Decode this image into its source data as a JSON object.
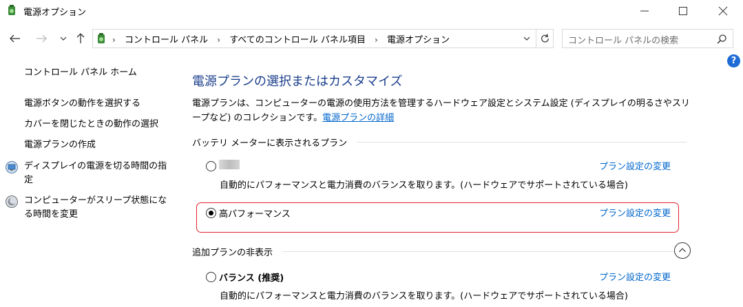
{
  "window": {
    "title": "電源オプション",
    "app_icon": "power-options-icon"
  },
  "nav": {
    "breadcrumbs": [
      "コントロール パネル",
      "すべてのコントロール パネル項目",
      "電源オプション"
    ],
    "search_placeholder": "コントロール パネルの検索"
  },
  "help": {
    "label": "?"
  },
  "sidebar": {
    "home": "コントロール パネル ホーム",
    "items": [
      {
        "label": "電源ボタンの動作を選択する"
      },
      {
        "label": "カバーを閉じたときの動作の選択"
      },
      {
        "label": "電源プランの作成"
      },
      {
        "label": "ディスプレイの電源を切る時間の指定",
        "icon": "display-power-icon"
      },
      {
        "label": "コンピューターがスリープ状態になる時間を変更",
        "icon": "sleep-moon-icon"
      }
    ]
  },
  "main": {
    "title": "電源プランの選択またはカスタマイズ",
    "description": "電源プランは、コンピューターの電源の使用方法を管理するハードウェア設定とシステム設定 (ディスプレイの明るさやスリープなど) のコレクションです。",
    "description_link": "電源プランの詳細",
    "battery_section": "バッテリ メーターに表示されるプラン",
    "hidden_section": "追加プランの非表示",
    "plans": [
      {
        "name": "",
        "description": "自動的にパフォーマンスと電力消費のバランスを取ります。(ハードウェアでサポートされている場合)",
        "link": "プラン設定の変更",
        "selected": false
      },
      {
        "name": "高パフォーマンス",
        "description": "",
        "link": "プラン設定の変更",
        "selected": true
      },
      {
        "name": "バランス (推奨)",
        "description": "自動的にパフォーマンスと電力消費のバランスを取ります。(ハードウェアでサポートされている場合)",
        "link": "プラン設定の変更",
        "selected": false
      }
    ]
  },
  "colors": {
    "title_blue": "#1a3e8c",
    "link_blue": "#0066cc",
    "highlight_red": "#e0202a"
  }
}
